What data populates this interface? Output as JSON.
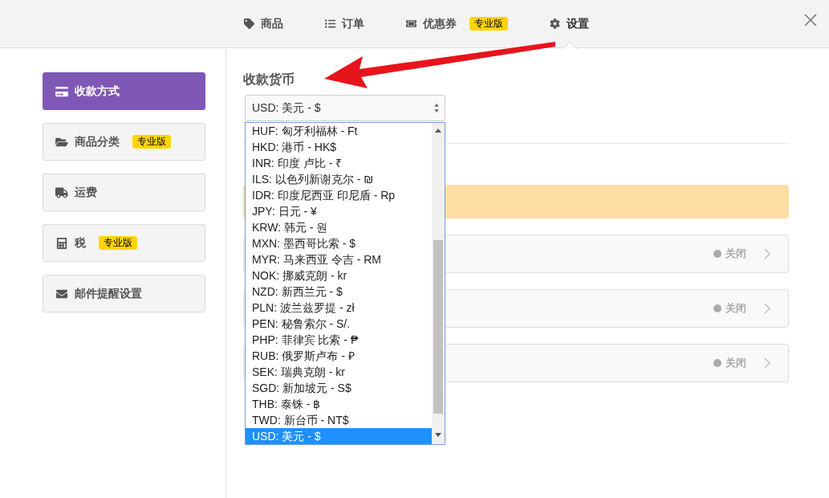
{
  "tabs": [
    {
      "label": "商品",
      "selected": false
    },
    {
      "label": "订单",
      "selected": false
    },
    {
      "label": "优惠券",
      "badge": "专业版",
      "selected": false
    },
    {
      "label": "设置",
      "selected": true
    }
  ],
  "sidebar": {
    "items": [
      {
        "label": "收款方式",
        "selected": true
      },
      {
        "label": "商品分类",
        "badge": "专业版",
        "selected": false
      },
      {
        "label": "运费",
        "selected": false
      },
      {
        "label": "税",
        "badge": "专业版",
        "selected": false
      },
      {
        "label": "邮件提醒设置",
        "selected": false
      }
    ]
  },
  "currency": {
    "title": "收款货币",
    "value": "USD: 美元 - $",
    "options": [
      {
        "label": "HUF: 匈牙利福林 - Ft",
        "selected": false
      },
      {
        "label": "HKD: 港币 - HK$",
        "selected": false
      },
      {
        "label": "INR: 印度 卢比 - ₹",
        "selected": false
      },
      {
        "label": "ILS: 以色列新谢克尔 - ₪",
        "selected": false
      },
      {
        "label": "IDR: 印度尼西亚 印尼盾 - Rp",
        "selected": false
      },
      {
        "label": "JPY: 日元 - ¥",
        "selected": false
      },
      {
        "label": "KRW: 韩元 - 원",
        "selected": false
      },
      {
        "label": "MXN: 墨西哥比索 - $",
        "selected": false
      },
      {
        "label": "MYR: 马来西亚 令吉 - RM",
        "selected": false
      },
      {
        "label": "NOK: 挪威克朗 - kr",
        "selected": false
      },
      {
        "label": "NZD: 新西兰元 - $",
        "selected": false
      },
      {
        "label": "PLN: 波兰兹罗提 - zł",
        "selected": false
      },
      {
        "label": "PEN: 秘鲁索尔 - S/.",
        "selected": false
      },
      {
        "label": "PHP: 菲律宾 比索 - ₱",
        "selected": false
      },
      {
        "label": "RUB: 俄罗斯卢布 - ₽",
        "selected": false
      },
      {
        "label": "SEK: 瑞典克朗 - kr",
        "selected": false
      },
      {
        "label": "SGD: 新加坡元 - S$",
        "selected": false
      },
      {
        "label": "THB: 泰铢 - ฿",
        "selected": false
      },
      {
        "label": "TWD: 新台币 - NT$",
        "selected": false
      },
      {
        "label": "USD: 美元 - $",
        "selected": true
      }
    ]
  },
  "payment_methods": [
    {
      "status": "关闭",
      "on": false
    },
    {
      "status": "关闭",
      "on": false
    },
    {
      "status": "关闭",
      "on": false
    }
  ]
}
